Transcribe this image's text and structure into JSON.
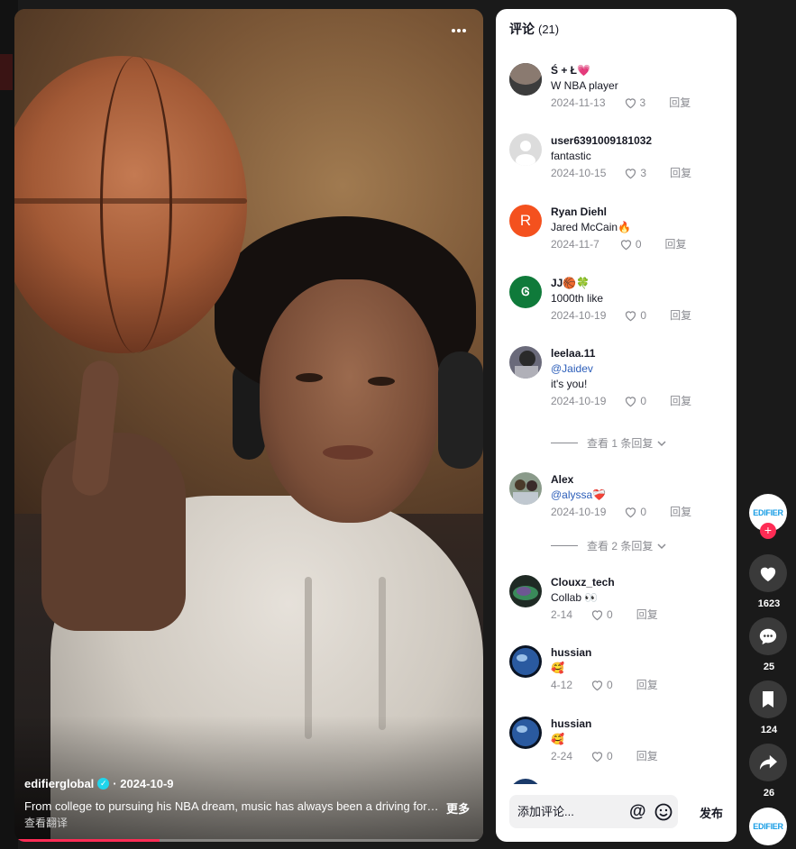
{
  "video": {
    "more_icon": "more-dots-icon",
    "author": "edifierglobal",
    "date_sep": "· 2024-10-9",
    "caption": "From college to pursuing his NBA dream, music has always been a driving force in his journey.",
    "more_label": "更多",
    "translate_label": "查看翻译",
    "progress_fraction": 0.31
  },
  "comments": {
    "title": "评论",
    "count": "(21)",
    "input_placeholder": "添加评论...",
    "at_symbol": "@",
    "post_label": "发布",
    "reply_label": "回复",
    "items": [
      {
        "name": "Ś + Ł💗",
        "text": "W NBA player",
        "date": "2024-11-13",
        "likes": "3",
        "avatar_color": "#4a4a4a",
        "avatar_letter": ""
      },
      {
        "name": "user6391009181032",
        "text": "fantastic",
        "date": "2024-10-15",
        "likes": "3",
        "avatar_color": "#d9d9d9",
        "avatar_letter": ""
      },
      {
        "name": "Ryan Diehl",
        "text": "Jared McCain🔥",
        "date": "2024-11-7",
        "likes": "0",
        "avatar_color": "#f4511e",
        "avatar_letter": "R"
      },
      {
        "name": "JJ🏀🍀",
        "text": "1000th like",
        "date": "2024-10-19",
        "likes": "0",
        "avatar_color": "#0f7a3a",
        "avatar_letter": "Ꮆ"
      },
      {
        "name": "leelaa.11",
        "mention": "@Jaidev",
        "text": "it's you!",
        "date": "2024-10-19",
        "likes": "0",
        "avatar_color": "#5a5a6a",
        "avatar_letter": "",
        "replies": "查看 1 条回复"
      },
      {
        "name": "Alex",
        "mention": "@alyssa❤️‍🩹",
        "text": "",
        "date": "2024-10-19",
        "likes": "0",
        "avatar_color": "#6a7a6a",
        "avatar_letter": "",
        "replies": "查看 2 条回复"
      },
      {
        "name": "Clouxz_tech",
        "text": "Collab 👀",
        "date": "2-14",
        "likes": "0",
        "avatar_color": "#2a3a2a",
        "avatar_letter": ""
      },
      {
        "name": "hussian",
        "text": "🥰",
        "date": "4-12",
        "likes": "0",
        "avatar_color": "#1a3a6a",
        "avatar_letter": ""
      },
      {
        "name": "hussian",
        "text": "🥰",
        "date": "2-24",
        "likes": "0",
        "avatar_color": "#1a3a6a",
        "avatar_letter": ""
      }
    ]
  },
  "actions": {
    "brand_avatar": "EDIFIER",
    "follow": "+",
    "likes": "1623",
    "comments": "25",
    "saves": "124",
    "shares": "26"
  }
}
